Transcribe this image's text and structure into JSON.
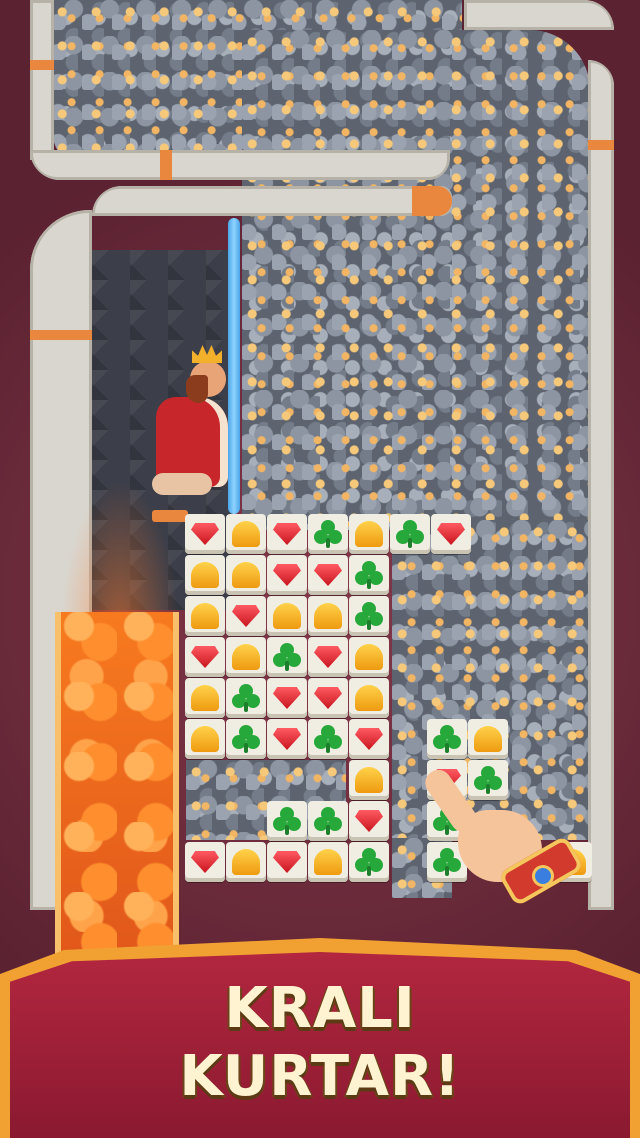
{
  "banner": {
    "line1": "KRALI",
    "line2": "KURTAR!"
  },
  "colors": {
    "background": "#6e2f3c",
    "pipe": "#d9d6cf",
    "pipe_band": "#e9873e",
    "lava": "#f77a1f",
    "glass_pin": "#4aa6e8",
    "banner": "#b2273f",
    "banner_text": "#fff3d2"
  },
  "board": {
    "tiles": [
      "gem",
      "helmet",
      "gem",
      "clover",
      "helmet",
      "clover",
      "gem",
      "helmet",
      "helmet",
      "gem",
      "gem",
      "clover",
      "helmet",
      "gem",
      "helmet",
      "helmet",
      "clover",
      "gem",
      "helmet",
      "clover",
      "gem",
      "helmet",
      "helmet",
      "clover",
      "gem",
      "gem",
      "helmet",
      "helmet",
      "clover",
      "gem",
      "clover",
      "gem",
      "helmet",
      "clover",
      "clover",
      "gem",
      "gem",
      "helmet",
      "gem",
      "helmet",
      "clover",
      "clover",
      "helmet",
      "gem",
      "clover",
      "clover",
      "clover",
      "helmet"
    ]
  },
  "icons": {
    "king": "king-character-icon",
    "hand": "pointing-hand-icon",
    "pin": "glass-pin-icon"
  }
}
